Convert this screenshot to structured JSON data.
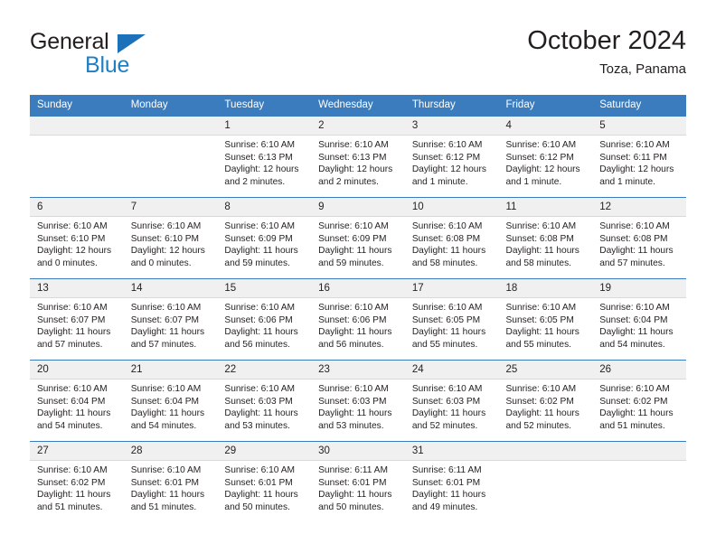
{
  "brand": {
    "name_top": "General",
    "name_bottom": "Blue",
    "triangle_color": "#1d71b8",
    "blue_color": "#1e7fc4"
  },
  "header": {
    "title": "October 2024",
    "subtitle": "Toza, Panama"
  },
  "theme": {
    "header_blue": "#3a7cbe",
    "daynum_bg": "#f0f0f0",
    "text": "#231f20"
  },
  "calendar": {
    "weekday_headers": [
      "Sunday",
      "Monday",
      "Tuesday",
      "Wednesday",
      "Thursday",
      "Friday",
      "Saturday"
    ],
    "weeks": [
      [
        {
          "day": "",
          "blank": true
        },
        {
          "day": "",
          "blank": true
        },
        {
          "day": "1",
          "sunrise": "Sunrise: 6:10 AM",
          "sunset": "Sunset: 6:13 PM",
          "daylight_1": "Daylight: 12 hours",
          "daylight_2": "and 2 minutes."
        },
        {
          "day": "2",
          "sunrise": "Sunrise: 6:10 AM",
          "sunset": "Sunset: 6:13 PM",
          "daylight_1": "Daylight: 12 hours",
          "daylight_2": "and 2 minutes."
        },
        {
          "day": "3",
          "sunrise": "Sunrise: 6:10 AM",
          "sunset": "Sunset: 6:12 PM",
          "daylight_1": "Daylight: 12 hours",
          "daylight_2": "and 1 minute."
        },
        {
          "day": "4",
          "sunrise": "Sunrise: 6:10 AM",
          "sunset": "Sunset: 6:12 PM",
          "daylight_1": "Daylight: 12 hours",
          "daylight_2": "and 1 minute."
        },
        {
          "day": "5",
          "sunrise": "Sunrise: 6:10 AM",
          "sunset": "Sunset: 6:11 PM",
          "daylight_1": "Daylight: 12 hours",
          "daylight_2": "and 1 minute."
        }
      ],
      [
        {
          "day": "6",
          "sunrise": "Sunrise: 6:10 AM",
          "sunset": "Sunset: 6:10 PM",
          "daylight_1": "Daylight: 12 hours",
          "daylight_2": "and 0 minutes."
        },
        {
          "day": "7",
          "sunrise": "Sunrise: 6:10 AM",
          "sunset": "Sunset: 6:10 PM",
          "daylight_1": "Daylight: 12 hours",
          "daylight_2": "and 0 minutes."
        },
        {
          "day": "8",
          "sunrise": "Sunrise: 6:10 AM",
          "sunset": "Sunset: 6:09 PM",
          "daylight_1": "Daylight: 11 hours",
          "daylight_2": "and 59 minutes."
        },
        {
          "day": "9",
          "sunrise": "Sunrise: 6:10 AM",
          "sunset": "Sunset: 6:09 PM",
          "daylight_1": "Daylight: 11 hours",
          "daylight_2": "and 59 minutes."
        },
        {
          "day": "10",
          "sunrise": "Sunrise: 6:10 AM",
          "sunset": "Sunset: 6:08 PM",
          "daylight_1": "Daylight: 11 hours",
          "daylight_2": "and 58 minutes."
        },
        {
          "day": "11",
          "sunrise": "Sunrise: 6:10 AM",
          "sunset": "Sunset: 6:08 PM",
          "daylight_1": "Daylight: 11 hours",
          "daylight_2": "and 58 minutes."
        },
        {
          "day": "12",
          "sunrise": "Sunrise: 6:10 AM",
          "sunset": "Sunset: 6:08 PM",
          "daylight_1": "Daylight: 11 hours",
          "daylight_2": "and 57 minutes."
        }
      ],
      [
        {
          "day": "13",
          "sunrise": "Sunrise: 6:10 AM",
          "sunset": "Sunset: 6:07 PM",
          "daylight_1": "Daylight: 11 hours",
          "daylight_2": "and 57 minutes."
        },
        {
          "day": "14",
          "sunrise": "Sunrise: 6:10 AM",
          "sunset": "Sunset: 6:07 PM",
          "daylight_1": "Daylight: 11 hours",
          "daylight_2": "and 57 minutes."
        },
        {
          "day": "15",
          "sunrise": "Sunrise: 6:10 AM",
          "sunset": "Sunset: 6:06 PM",
          "daylight_1": "Daylight: 11 hours",
          "daylight_2": "and 56 minutes."
        },
        {
          "day": "16",
          "sunrise": "Sunrise: 6:10 AM",
          "sunset": "Sunset: 6:06 PM",
          "daylight_1": "Daylight: 11 hours",
          "daylight_2": "and 56 minutes."
        },
        {
          "day": "17",
          "sunrise": "Sunrise: 6:10 AM",
          "sunset": "Sunset: 6:05 PM",
          "daylight_1": "Daylight: 11 hours",
          "daylight_2": "and 55 minutes."
        },
        {
          "day": "18",
          "sunrise": "Sunrise: 6:10 AM",
          "sunset": "Sunset: 6:05 PM",
          "daylight_1": "Daylight: 11 hours",
          "daylight_2": "and 55 minutes."
        },
        {
          "day": "19",
          "sunrise": "Sunrise: 6:10 AM",
          "sunset": "Sunset: 6:04 PM",
          "daylight_1": "Daylight: 11 hours",
          "daylight_2": "and 54 minutes."
        }
      ],
      [
        {
          "day": "20",
          "sunrise": "Sunrise: 6:10 AM",
          "sunset": "Sunset: 6:04 PM",
          "daylight_1": "Daylight: 11 hours",
          "daylight_2": "and 54 minutes."
        },
        {
          "day": "21",
          "sunrise": "Sunrise: 6:10 AM",
          "sunset": "Sunset: 6:04 PM",
          "daylight_1": "Daylight: 11 hours",
          "daylight_2": "and 54 minutes."
        },
        {
          "day": "22",
          "sunrise": "Sunrise: 6:10 AM",
          "sunset": "Sunset: 6:03 PM",
          "daylight_1": "Daylight: 11 hours",
          "daylight_2": "and 53 minutes."
        },
        {
          "day": "23",
          "sunrise": "Sunrise: 6:10 AM",
          "sunset": "Sunset: 6:03 PM",
          "daylight_1": "Daylight: 11 hours",
          "daylight_2": "and 53 minutes."
        },
        {
          "day": "24",
          "sunrise": "Sunrise: 6:10 AM",
          "sunset": "Sunset: 6:03 PM",
          "daylight_1": "Daylight: 11 hours",
          "daylight_2": "and 52 minutes."
        },
        {
          "day": "25",
          "sunrise": "Sunrise: 6:10 AM",
          "sunset": "Sunset: 6:02 PM",
          "daylight_1": "Daylight: 11 hours",
          "daylight_2": "and 52 minutes."
        },
        {
          "day": "26",
          "sunrise": "Sunrise: 6:10 AM",
          "sunset": "Sunset: 6:02 PM",
          "daylight_1": "Daylight: 11 hours",
          "daylight_2": "and 51 minutes."
        }
      ],
      [
        {
          "day": "27",
          "sunrise": "Sunrise: 6:10 AM",
          "sunset": "Sunset: 6:02 PM",
          "daylight_1": "Daylight: 11 hours",
          "daylight_2": "and 51 minutes."
        },
        {
          "day": "28",
          "sunrise": "Sunrise: 6:10 AM",
          "sunset": "Sunset: 6:01 PM",
          "daylight_1": "Daylight: 11 hours",
          "daylight_2": "and 51 minutes."
        },
        {
          "day": "29",
          "sunrise": "Sunrise: 6:10 AM",
          "sunset": "Sunset: 6:01 PM",
          "daylight_1": "Daylight: 11 hours",
          "daylight_2": "and 50 minutes."
        },
        {
          "day": "30",
          "sunrise": "Sunrise: 6:11 AM",
          "sunset": "Sunset: 6:01 PM",
          "daylight_1": "Daylight: 11 hours",
          "daylight_2": "and 50 minutes."
        },
        {
          "day": "31",
          "sunrise": "Sunrise: 6:11 AM",
          "sunset": "Sunset: 6:01 PM",
          "daylight_1": "Daylight: 11 hours",
          "daylight_2": "and 49 minutes."
        },
        {
          "day": "",
          "blank": true
        },
        {
          "day": "",
          "blank": true
        }
      ]
    ]
  }
}
